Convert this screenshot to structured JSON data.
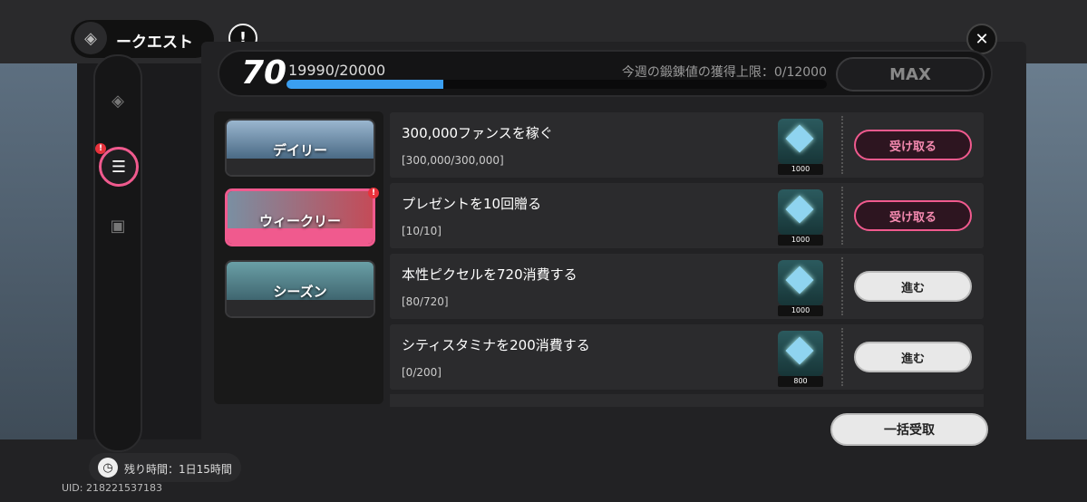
{
  "header": {
    "title": "ークエスト",
    "info_icon": "info-icon",
    "close_icon": "close-icon"
  },
  "level": {
    "number": "70",
    "progress_text": "19990/20000",
    "weekly_limit_text": "今週の鍛錬値の獲得上限：0/12000",
    "progress_fraction": 0.29,
    "max_label": "MAX"
  },
  "categories": [
    {
      "label": "デイリー"
    },
    {
      "label": "ウィークリー",
      "badge": "!"
    },
    {
      "label": "シーズン"
    }
  ],
  "quests": [
    {
      "title": "300,000ファンスを稼ぐ",
      "progress": "[300,000/300,000]",
      "reward": "1000",
      "action": "受け取る"
    },
    {
      "title": "プレゼントを10回贈る",
      "progress": "[10/10]",
      "reward": "1000",
      "action": "受け取る"
    },
    {
      "title": "本性ピクセルを720消費する",
      "progress": "[80/720]",
      "reward": "1000",
      "action": "進む"
    },
    {
      "title": "シティスタミナを200消費する",
      "progress": "[0/200]",
      "reward": "800",
      "action": "進む"
    }
  ],
  "bulk_button": "一括受取",
  "timer": {
    "text": "残り時間：1日15時間"
  },
  "uid": "UID: 218221537183",
  "rail": {
    "badge": "!"
  },
  "colors": {
    "accent": "#f05a8e",
    "progress": "#3a9ef0",
    "panel": "#222224"
  }
}
